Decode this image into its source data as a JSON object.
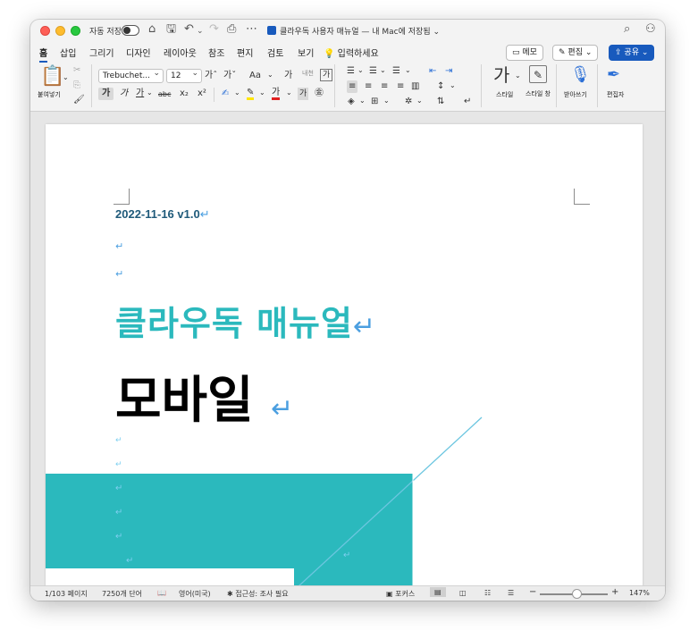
{
  "titlebar": {
    "autosave_label": "자동 저장",
    "doc_title": "클라우독 사용자 매뉴얼 — 내 Mac에 저장됨 ⌄"
  },
  "tabs": [
    {
      "label": "홈",
      "active": true
    },
    {
      "label": "삽입"
    },
    {
      "label": "그리기"
    },
    {
      "label": "디자인"
    },
    {
      "label": "레이아웃"
    },
    {
      "label": "참조"
    },
    {
      "label": "편지"
    },
    {
      "label": "검토"
    },
    {
      "label": "보기"
    }
  ],
  "tell_me": "입력하세요",
  "header_buttons": {
    "memo": "메모",
    "edit": "편집 ⌄",
    "share": "공유 ⌄"
  },
  "ribbon": {
    "paste_label": "붙여넣기",
    "font_name": "Trebuchet...",
    "font_size": "12",
    "grow_font": "가ˆ",
    "shrink_font": "가ˇ",
    "change_case": "Aa",
    "clear_format": "가",
    "phonetic": "내천",
    "border_char": "가",
    "bold": "가",
    "italic": "가",
    "underline": "가",
    "strike": "abc",
    "subscript": "x₂",
    "superscript": "x²",
    "font_color_letter": "가",
    "char_shade": "가",
    "enclose": "㊎",
    "styles_label": "스타일",
    "styles_glyph": "가",
    "style_pane_label": "스타일 창",
    "dictate_label": "받아쓰기",
    "editor_label": "편집자"
  },
  "document": {
    "date_line": "2022-11-16 v1.0",
    "para_mark": "↵",
    "title_teal": "클라우독 매뉴얼",
    "title_black": "모바일"
  },
  "statusbar": {
    "page": "1/103 페이지",
    "words": "7250개 단어",
    "language": "영어(미국)",
    "accessibility": "접근성: 조사 필요",
    "focus": "포커스",
    "zoom": "147%",
    "zoom_position": 0.55
  },
  "colors": {
    "accent": "#185abd",
    "teal": "#2bb9bd",
    "para_mark": "#4b9fe0"
  }
}
